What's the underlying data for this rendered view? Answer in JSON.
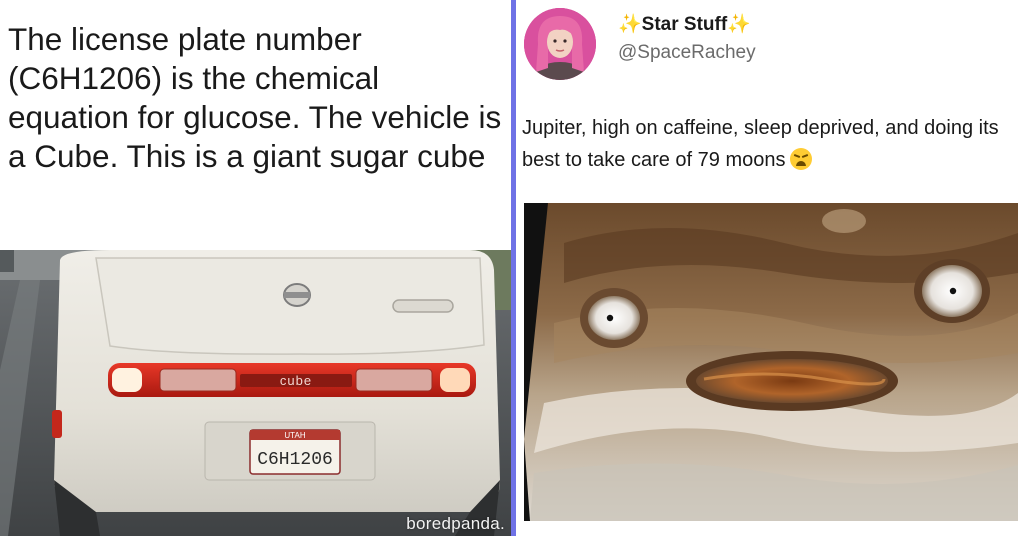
{
  "left": {
    "caption": "The license plate number (C6H1206) is the chemical equation for glucose. The vehicle is a Cube. This is a giant sugar cube",
    "plate_state": "UTAH",
    "plate_number": "C6H1206",
    "car_badge": "cube",
    "watermark": "boredpanda."
  },
  "right": {
    "display_name": "Star Stuff",
    "sparkle_left": "✨",
    "sparkle_right": "✨",
    "handle": "@SpaceRachey",
    "tweet_text": "Jupiter, high on caffeine, sleep deprived, and doing its best to take care of 79 moons"
  },
  "colors": {
    "divider": "#6f72e6",
    "tail_light": "#d42a1f",
    "car_body": "#e8e5dc"
  },
  "icons": {
    "emoji": "weary-face-icon",
    "sparkles": "sparkles-icon"
  }
}
